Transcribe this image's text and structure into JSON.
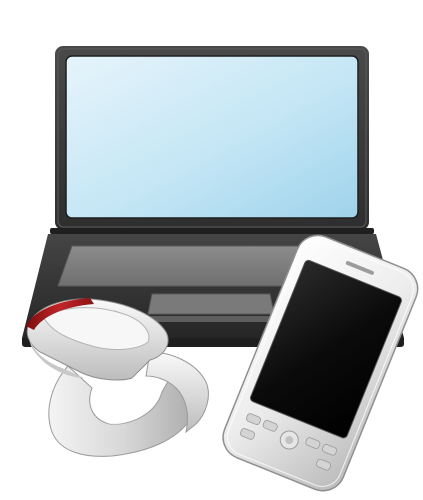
{
  "scene": {
    "background": "#ffffff",
    "objects": [
      "laptop",
      "wrist-device",
      "smartphone"
    ]
  },
  "laptop": {
    "icon": "laptop-icon",
    "body_color": "#3a3a3a",
    "screen_color_top": "#e3f2fa",
    "screen_color_bottom": "#a9d8ee"
  },
  "wrist_device": {
    "icon": "wrist-device-icon",
    "body_color": "#e9e9e9",
    "accent_color": "#b11a1a"
  },
  "smartphone": {
    "icon": "smartphone-icon",
    "body_color": "#e8e8e8",
    "screen_color": "#101010"
  }
}
